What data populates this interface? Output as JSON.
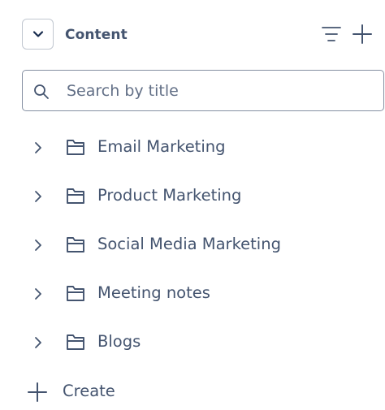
{
  "header": {
    "title": "Content",
    "collapse_icon": "chevron-down-icon",
    "filter_icon": "filter-lines-icon",
    "add_icon": "plus-icon"
  },
  "search": {
    "placeholder": "Search by title",
    "value": "",
    "icon": "search-icon"
  },
  "tree": {
    "items": [
      {
        "label": "Email Marketing",
        "icon": "folder-icon",
        "expander": "chevron-right-icon"
      },
      {
        "label": "Product Marketing",
        "icon": "folder-icon",
        "expander": "chevron-right-icon"
      },
      {
        "label": "Social Media Marketing",
        "icon": "folder-icon",
        "expander": "chevron-right-icon"
      },
      {
        "label": "Meeting notes",
        "icon": "folder-icon",
        "expander": "chevron-right-icon"
      },
      {
        "label": "Blogs",
        "icon": "folder-icon",
        "expander": "chevron-right-icon"
      }
    ]
  },
  "create": {
    "label": "Create",
    "icon": "plus-icon"
  },
  "colors": {
    "text": "#44546f",
    "icon": "#44546f",
    "border": "#8590a2"
  }
}
